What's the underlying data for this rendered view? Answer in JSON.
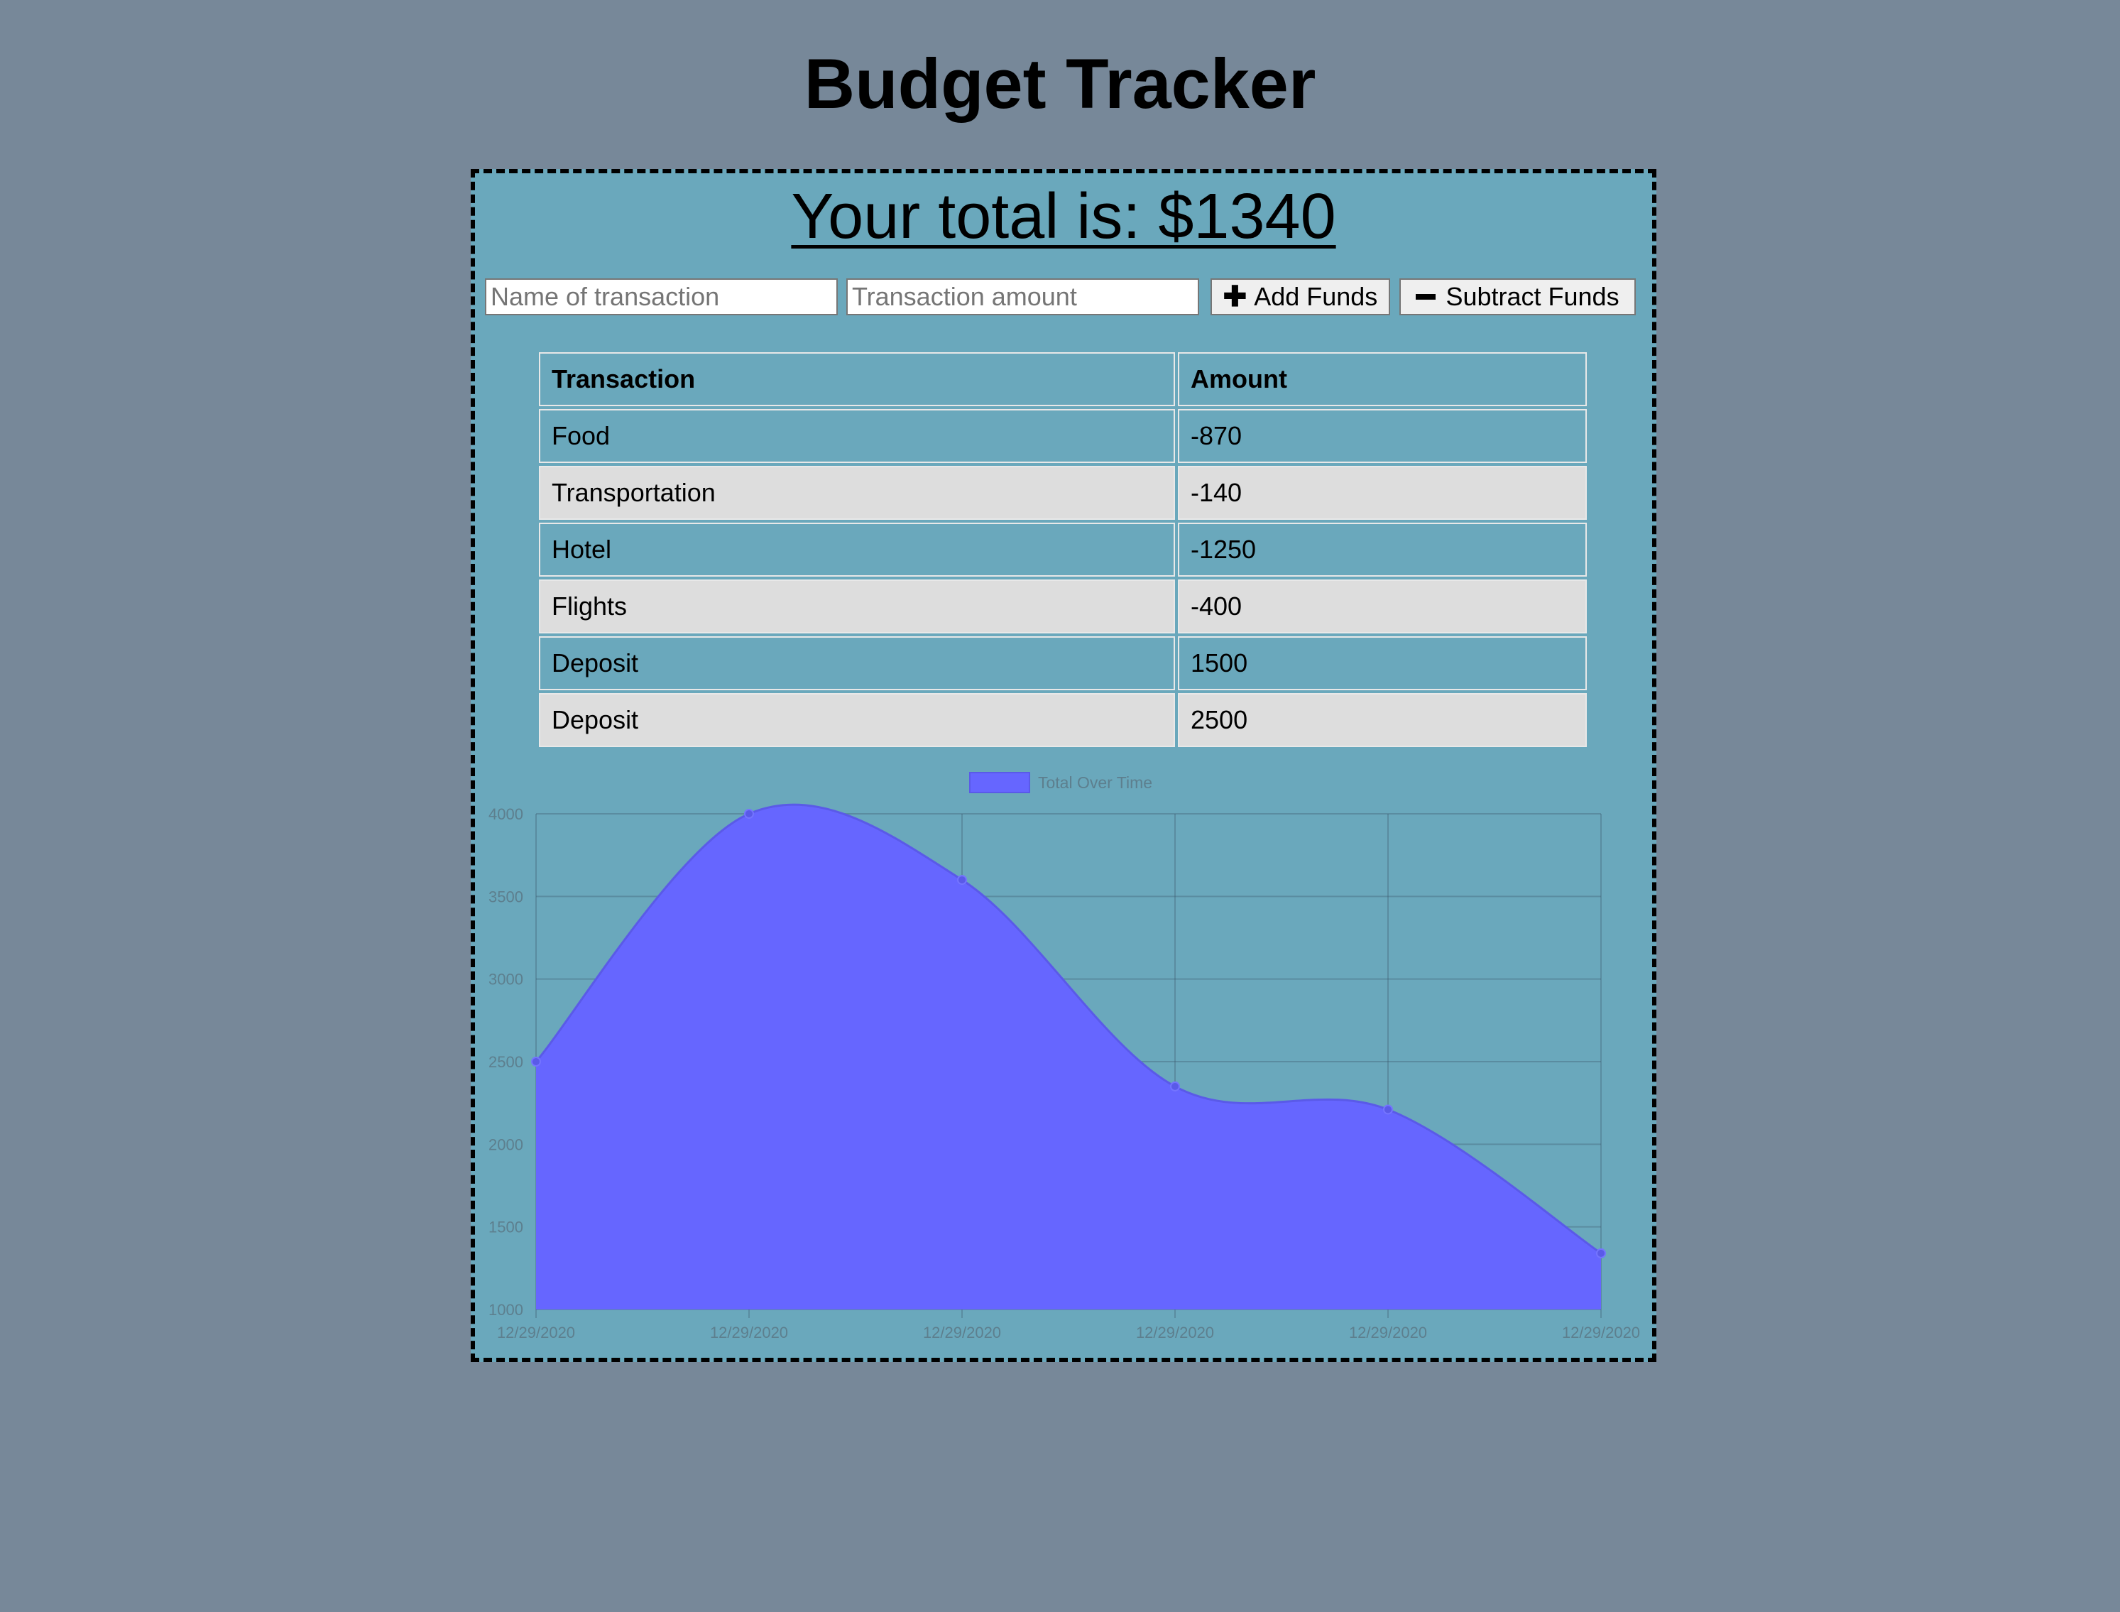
{
  "app": {
    "title": "Budget Tracker"
  },
  "summary": {
    "total_text": "Your total is: $1340"
  },
  "form": {
    "name_placeholder": "Name of transaction",
    "amount_placeholder": "Transaction amount",
    "add_label": "Add Funds",
    "subtract_label": "Subtract Funds",
    "add_icon": "plus-icon",
    "subtract_icon": "minus-icon"
  },
  "table": {
    "headers": [
      "Transaction",
      "Amount"
    ],
    "rows": [
      {
        "name": "Food",
        "amount": "-870"
      },
      {
        "name": "Transportation",
        "amount": "-140"
      },
      {
        "name": "Hotel",
        "amount": "-1250"
      },
      {
        "name": "Flights",
        "amount": "-400"
      },
      {
        "name": "Deposit",
        "amount": "1500"
      },
      {
        "name": "Deposit",
        "amount": "2500"
      }
    ]
  },
  "colors": {
    "page_background": "#778899",
    "panel_background": "#6aa8bc",
    "series_fill": "#6666ff",
    "even_row": "#dddddd"
  },
  "chart_data": {
    "type": "area",
    "x": [
      "12/29/2020",
      "12/29/2020",
      "12/29/2020",
      "12/29/2020",
      "12/29/2020",
      "12/29/2020"
    ],
    "series": [
      {
        "name": "Total Over Time",
        "values": [
          2500,
          4000,
          3600,
          2350,
          2210,
          1340
        ]
      }
    ],
    "ylim": [
      1000,
      4000
    ],
    "yticks": [
      1000,
      1500,
      2000,
      2500,
      3000,
      3500,
      4000
    ],
    "grid": true,
    "legend": "top-center",
    "curve": "smooth"
  }
}
